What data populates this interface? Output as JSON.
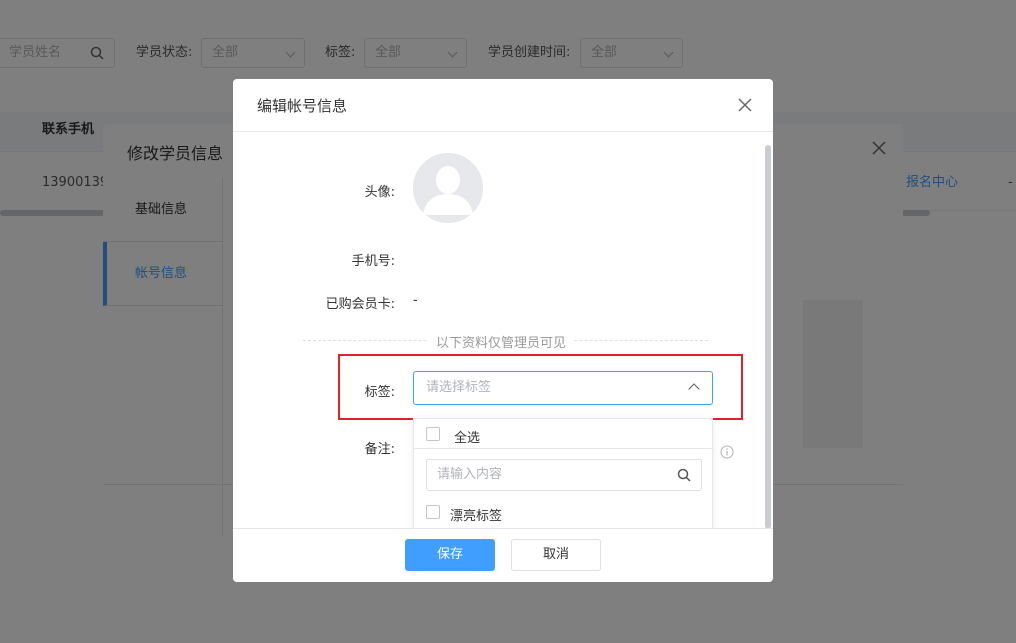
{
  "filters": {
    "name_placeholder": "学员姓名",
    "status_label": "学员状态:",
    "status_value": "全部",
    "tag_label": "标签:",
    "tag_value": "全部",
    "created_label": "学员创建时间:",
    "created_value": "全部"
  },
  "table": {
    "col_phone": "联系手机",
    "row_phone": "13900139",
    "row_link": "报名中心",
    "row_dash": "-"
  },
  "profile_dialog": {
    "title": "修改学员信息",
    "tabs": [
      {
        "label": "基础信息"
      },
      {
        "label": "帐号信息"
      }
    ]
  },
  "account_dialog": {
    "title": "编辑帐号信息",
    "avatar_label": "头像:",
    "phone_label": "手机号:",
    "member_card_label": "已购会员卡:",
    "member_card_value": "-",
    "divider_text": "以下资料仅管理员可见",
    "tag_label": "标签:",
    "tag_placeholder": "请选择标签",
    "remark_label": "备注:",
    "dropdown": {
      "select_all_label": "全选",
      "search_placeholder": "请输入内容",
      "options": [
        {
          "label": "漂亮标签",
          "checked": false
        }
      ]
    },
    "save_label": "保存",
    "cancel_label": "取消"
  },
  "colors": {
    "primary": "#409eff",
    "highlight": "#e0232a",
    "overlay": "rgba(0,0,0,0.5)"
  }
}
